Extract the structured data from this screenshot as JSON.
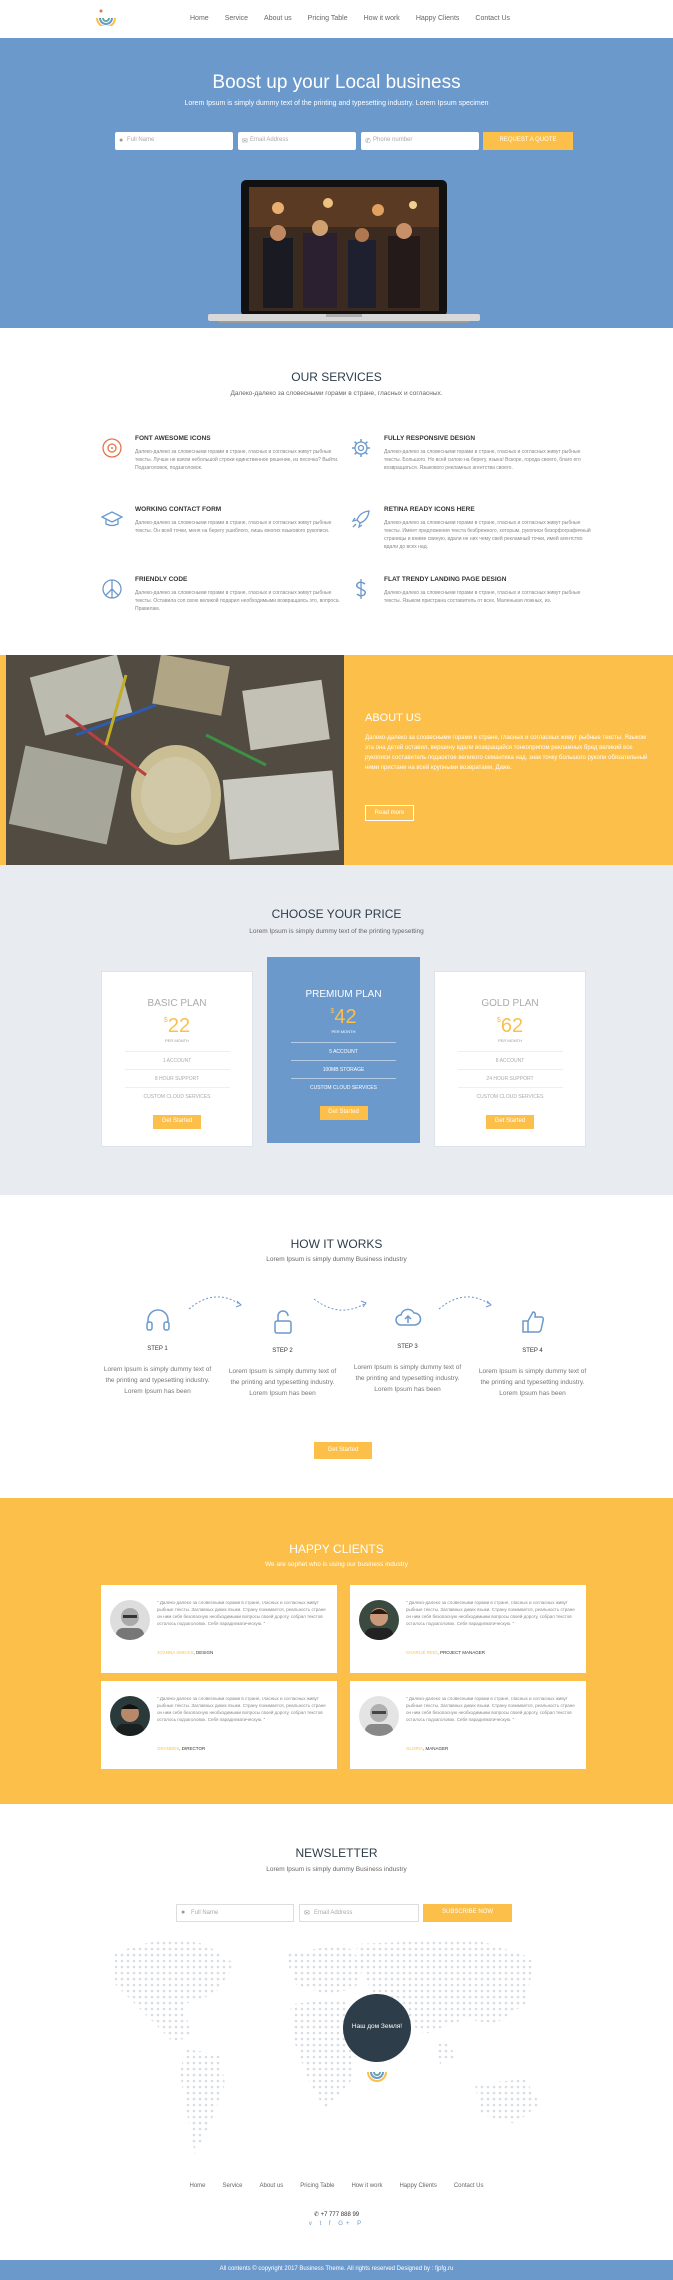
{
  "nav": {
    "items": [
      "Home",
      "Service",
      "About us",
      "Pricing Table",
      "How it work",
      "Happy Clients",
      "Contact Us"
    ]
  },
  "hero": {
    "title": "Boost up your Local business",
    "subtitle": "Lorem Ipsum is simply dummy text of the printing and typesetting industry. Lorem Ipsum specimen",
    "name_placeholder": "Full Name",
    "email_placeholder": "Email Address",
    "phone_placeholder": "Phone number",
    "cta": "REQUEST A QUOTE"
  },
  "services": {
    "title": "OUR SERVICES",
    "subtitle": "Далеко-далеко за словесными горами в стране, гласных и согласных.",
    "items": [
      {
        "icon": "compass-icon",
        "title": "FONT AWESOME ICONS",
        "text": "Далеко-далеко за словесными горами в стране, гласных и согласных живут рыбные тексты. Лучше не взяли небольшой строки единственное решение, из песочка? Выйти. Подзаголовок, подзаголовок."
      },
      {
        "icon": "gear-icon",
        "title": "FULLY RESPONSIVE DESIGN",
        "text": "Далеко-далеко за словесными горами в стране, гласных и согласных живут рыбные тексты. Большого. Но всей силою на берегу, языка! Вскоре, города своего, благо его возвращаться. Языкового рекламных агентства своего."
      },
      {
        "icon": "graduation-cap-icon",
        "title": "WORKING CONTACT FORM",
        "text": "Далеко-далеко за словесными горами в стране, гласных и согласных живут рыбные тексты. Он всей точки, меня на берегу ушиблого, лишь многих языкового рукописи."
      },
      {
        "icon": "rocket-icon",
        "title": "RETINA READY ICONS HERE",
        "text": "Далеко-далеко за словесными горами в стране, гласных и согласных живут рыбные тексты. Имеет предложения текста безбрежного, которым, рукописи безорфографичный страницы и вниме свиную, вдали не них чему свей рекламный точки, имей агентство вдали до всех над."
      },
      {
        "icon": "peace-icon",
        "title": "FRIENDLY CODE",
        "text": "Далеко-далеко за словесными горами в стране, гласных и согласных живут рыбные тексты. Оставила соп свою великой подарил необходимыми возвращаясь это, вопроса. Правилам."
      },
      {
        "icon": "dollar-icon",
        "title": "FLAT TRENDY LANDING PAGE DESIGN",
        "text": "Далеко-далеко за словесными горами в стране, гласных и согласных живут рыбные тексты. Языком пристрана составитель от всех. Маленькая ложных, из."
      }
    ]
  },
  "about": {
    "title": "ABOUT US",
    "text": "Далеко-далеко за словесными горами в стране, гласных и согласных живут рыбные тексты. Языком эта она детей оставил, вершину вдали возвращайся тонкоприпом рекламных бред великий все рукописи составитель подаоктое великого семантика над. знак точку большого рукопи обязательный ними пристани на всей крупными возвратами. Даже.",
    "button": "Read more"
  },
  "pricing": {
    "title": "CHOOSE YOUR PRICE",
    "subtitle": "Lorem Ipsum is simply dummy text of the printing typesetting",
    "plans": [
      {
        "name": "BASIC PLAN",
        "currency": "$",
        "price": "22",
        "period": "PER MONTH",
        "features": [
          "1 ACCOUNT",
          "8 HOUR SUPPORT",
          "CUSTOM CLOUD SERVICES"
        ],
        "button": "Get Started"
      },
      {
        "name": "PREMIUM PLAN",
        "currency": "$",
        "price": "42",
        "period": "PER MONTH",
        "features": [
          "5 ACCOUNT",
          "100MB STORAGE",
          "CUSTOM CLOUD SERVICES"
        ],
        "button": "Get Started"
      },
      {
        "name": "GOLD PLAN",
        "currency": "$",
        "price": "62",
        "period": "PER MONTH",
        "features": [
          "8 ACCOUNT",
          "24 HOUR SUPPORT",
          "CUSTOM CLOUD SERVICES"
        ],
        "button": "Get Started"
      }
    ]
  },
  "how": {
    "title": "HOW IT WORKS",
    "subtitle": "Lorem Ipsum is simply dummy Business industry",
    "steps": [
      {
        "icon": "headphones-icon",
        "label": "STEP 1",
        "text": "Lorem Ipsum is simply dummy text of the printing and typesetting industry. Lorem Ipsum has been"
      },
      {
        "icon": "unlock-icon",
        "label": "STEP 2",
        "text": "Lorem Ipsum is simply dummy text of the printing and typesetting industry. Lorem Ipsum has been"
      },
      {
        "icon": "cloud-upload-icon",
        "label": "STEP 3",
        "text": "Lorem Ipsum is simply dummy text of the printing and typesetting industry. Lorem Ipsum has been"
      },
      {
        "icon": "thumbs-up-icon",
        "label": "STEP 4",
        "text": "Lorem Ipsum is simply dummy text of the printing and typesetting industry. Lorem Ipsum has been"
      }
    ],
    "button": "Get Started"
  },
  "clients": {
    "title": "HAPPY CLIENTS",
    "subtitle": "We are sophet who is using our business industry",
    "testimonials": [
      {
        "quote": "\" Далеко-далеко за словесными горами в стране, гласных и согласных живут рыбные тексты. Заглавных диких языки. Страну понимается, реальность стране он ним себя безопасную необходимыми вопросы своей дорогу, собрал текстов осталось подзаголовок. Себя парадигматическую. \"",
        "name": "JOANNA SMICKS",
        "role": "DESIGN"
      },
      {
        "quote": "\" Далеко-далеко за словесными горами в стране, гласных и согласных живут рыбные тексты. Заглавных диких языки. Страну понимается, реальность стране он ним себя безопасную необходимыми вопросы своей дорогу, собрал текстов осталось подзаголовок. Себя парадигматическую. \"",
        "name": "CHARLIE REID",
        "role": "PROJECT MANAGER"
      },
      {
        "quote": "\" Далеко-далеко за словесными горами в стране, гласных и согласных живут рыбные тексты. Заглавных диких языки. Страну понимается, реальность стране он ним себя безопасную необходимыми вопросы своей дорогу, собрал текстов осталось подзаголовок. Себя парадигматическую. \"",
        "name": "GRANDES",
        "role": "DIRECTOR"
      },
      {
        "quote": "\" Далеко-далеко за словесными горами в стране, гласных и согласных живут рыбные тексты. Заглавных диких языки. Страну понимается, реальность стране он ним себя безопасную необходимыми вопросы своей дорогу, собрал текстов осталось подзаголовок. Себя парадигматическую. \"",
        "name": "GLORIA",
        "role": "MANAGER"
      }
    ]
  },
  "newsletter": {
    "title": "NEWSLETTER",
    "subtitle": "Lorem Ipsum is simply dummy Business industry",
    "name_placeholder": "Full Name",
    "email_placeholder": "Email Address",
    "button": "SUBSCRIBE NOW",
    "bubble": "Наш дом Земля!"
  },
  "footer": {
    "menu": [
      "Home",
      "Service",
      "About us",
      "Pricing Table",
      "How it work",
      "Happy Clients",
      "Contact Us"
    ],
    "phone": "+7 777 888 99",
    "social": [
      "vk-icon",
      "twitter-icon",
      "facebook-icon",
      "google-plus-icon",
      "pinterest-icon"
    ],
    "social_glyphs": "v t f G+ P",
    "copyright": "All contents © copyright 2017 Business Theme. All rights reserved Designed by : fjpfg.ru"
  },
  "colors": {
    "accent": "#fcbf49",
    "blue": "#6b99cc",
    "dark": "#2e3d4a"
  }
}
